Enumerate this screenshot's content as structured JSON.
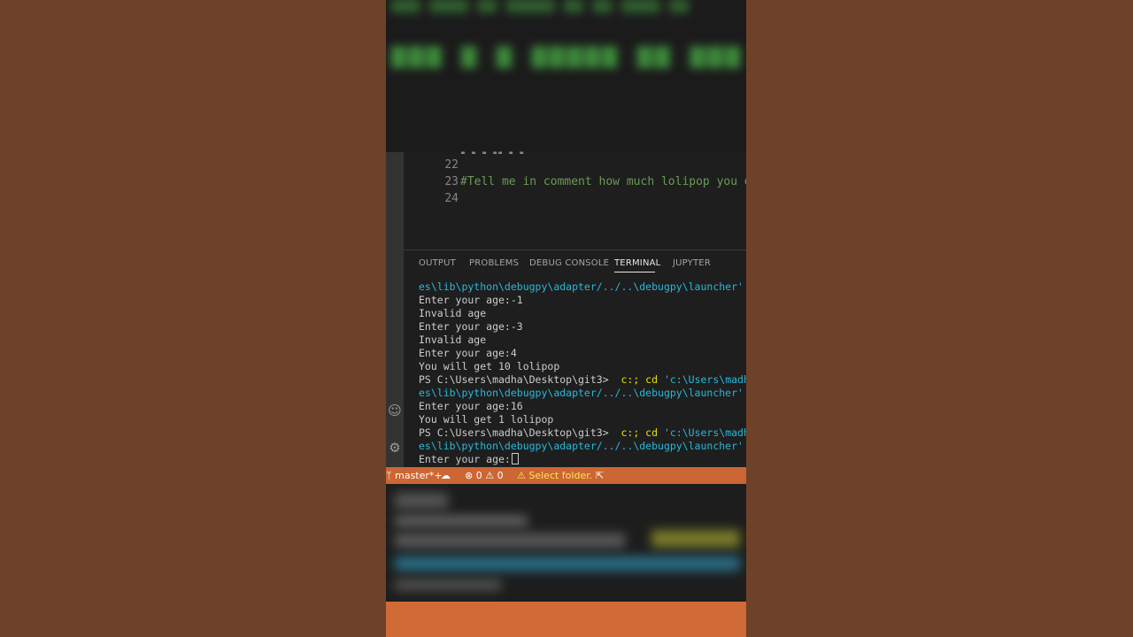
{
  "editor": {
    "lines": [
      {
        "number": "22",
        "text": ""
      },
      {
        "number": "23",
        "text": "#Tell me in comment how much lolipop you d"
      },
      {
        "number": "24",
        "text": ""
      }
    ]
  },
  "panel": {
    "tabs": [
      {
        "label": "OUTPUT",
        "active": false
      },
      {
        "label": "PROBLEMS",
        "active": false
      },
      {
        "label": "DEBUG CONSOLE",
        "active": false
      },
      {
        "label": "TERMINAL",
        "active": true
      },
      {
        "label": "JUPYTER",
        "active": false
      }
    ]
  },
  "terminal": {
    "launcher_path": "es\\lib\\python\\debugpy\\adapter/../..\\debugpy\\launcher' '",
    "ps_prompt": "PS C:\\Users\\madha\\Desktop\\git3> ",
    "ps_cmd": " c:; cd ",
    "ps_path": "'c:\\Users\\madha",
    "out1": "Enter your age:-1",
    "out2": "Invalid age",
    "out3": "Enter your age:-3",
    "out4": "Invalid age",
    "out5": "Enter your age:4",
    "out6": "You will get 10 lolipop",
    "out7": "Enter your age:16",
    "out8": "You will get 1 lolipop",
    "prompt_current": "Enter your age:"
  },
  "statusbar": {
    "branch": "master*+",
    "errors": "0",
    "warnings": "0",
    "select_folder": "Select folder."
  },
  "colors": {
    "accent": "#cc6633",
    "terminal_cyan": "#29b8db",
    "terminal_yellow": "#e5e510",
    "comment_green": "#6a9955"
  }
}
